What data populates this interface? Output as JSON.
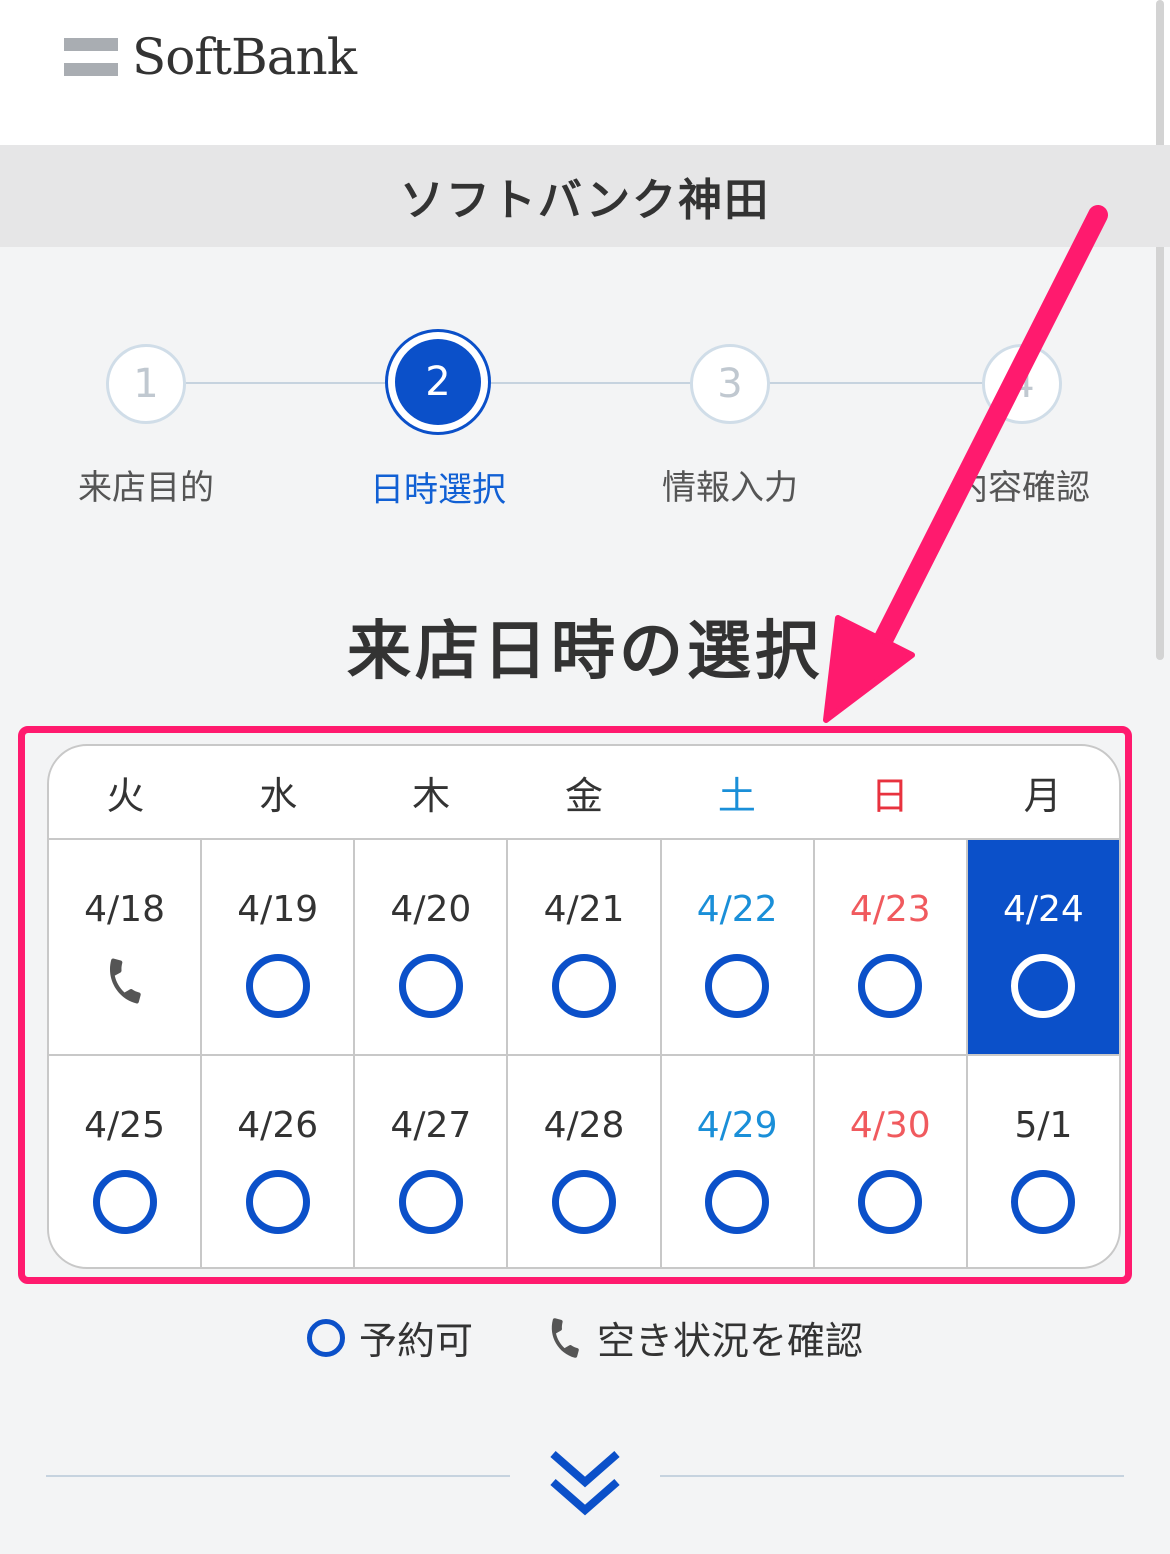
{
  "header": {
    "logo_text": "SoftBank"
  },
  "store": {
    "name": "ソフトバンク神田"
  },
  "steps": [
    {
      "number": "1",
      "label": "来店目的"
    },
    {
      "number": "2",
      "label": "日時選択"
    },
    {
      "number": "3",
      "label": "情報入力"
    },
    {
      "number": "4",
      "label": "内容確認"
    }
  ],
  "current_step": 2,
  "section_title": "来店日時の選択",
  "calendar": {
    "weekdays": [
      "火",
      "水",
      "木",
      "金",
      "土",
      "日",
      "月"
    ],
    "rows": [
      [
        {
          "date": "4/18",
          "status": "phone"
        },
        {
          "date": "4/19",
          "status": "available"
        },
        {
          "date": "4/20",
          "status": "available"
        },
        {
          "date": "4/21",
          "status": "available"
        },
        {
          "date": "4/22",
          "status": "available"
        },
        {
          "date": "4/23",
          "status": "available"
        },
        {
          "date": "4/24",
          "status": "available",
          "selected": true
        }
      ],
      [
        {
          "date": "4/25",
          "status": "available"
        },
        {
          "date": "4/26",
          "status": "available"
        },
        {
          "date": "4/27",
          "status": "available"
        },
        {
          "date": "4/28",
          "status": "available"
        },
        {
          "date": "4/29",
          "status": "available"
        },
        {
          "date": "4/30",
          "status": "available"
        },
        {
          "date": "5/1",
          "status": "available"
        }
      ]
    ]
  },
  "legend": {
    "available_label": "予約可",
    "phone_label": "空き状況を確認"
  },
  "colors": {
    "accent": "#0b50c9",
    "saturday": "#1a8fd8",
    "sunday": "#e8323e",
    "annotation": "#ff1a6e"
  },
  "icons": {
    "logo": "softbank-logo-icon",
    "phone": "phone-icon",
    "available": "circle-available-icon",
    "expand": "double-chevron-down-icon"
  }
}
